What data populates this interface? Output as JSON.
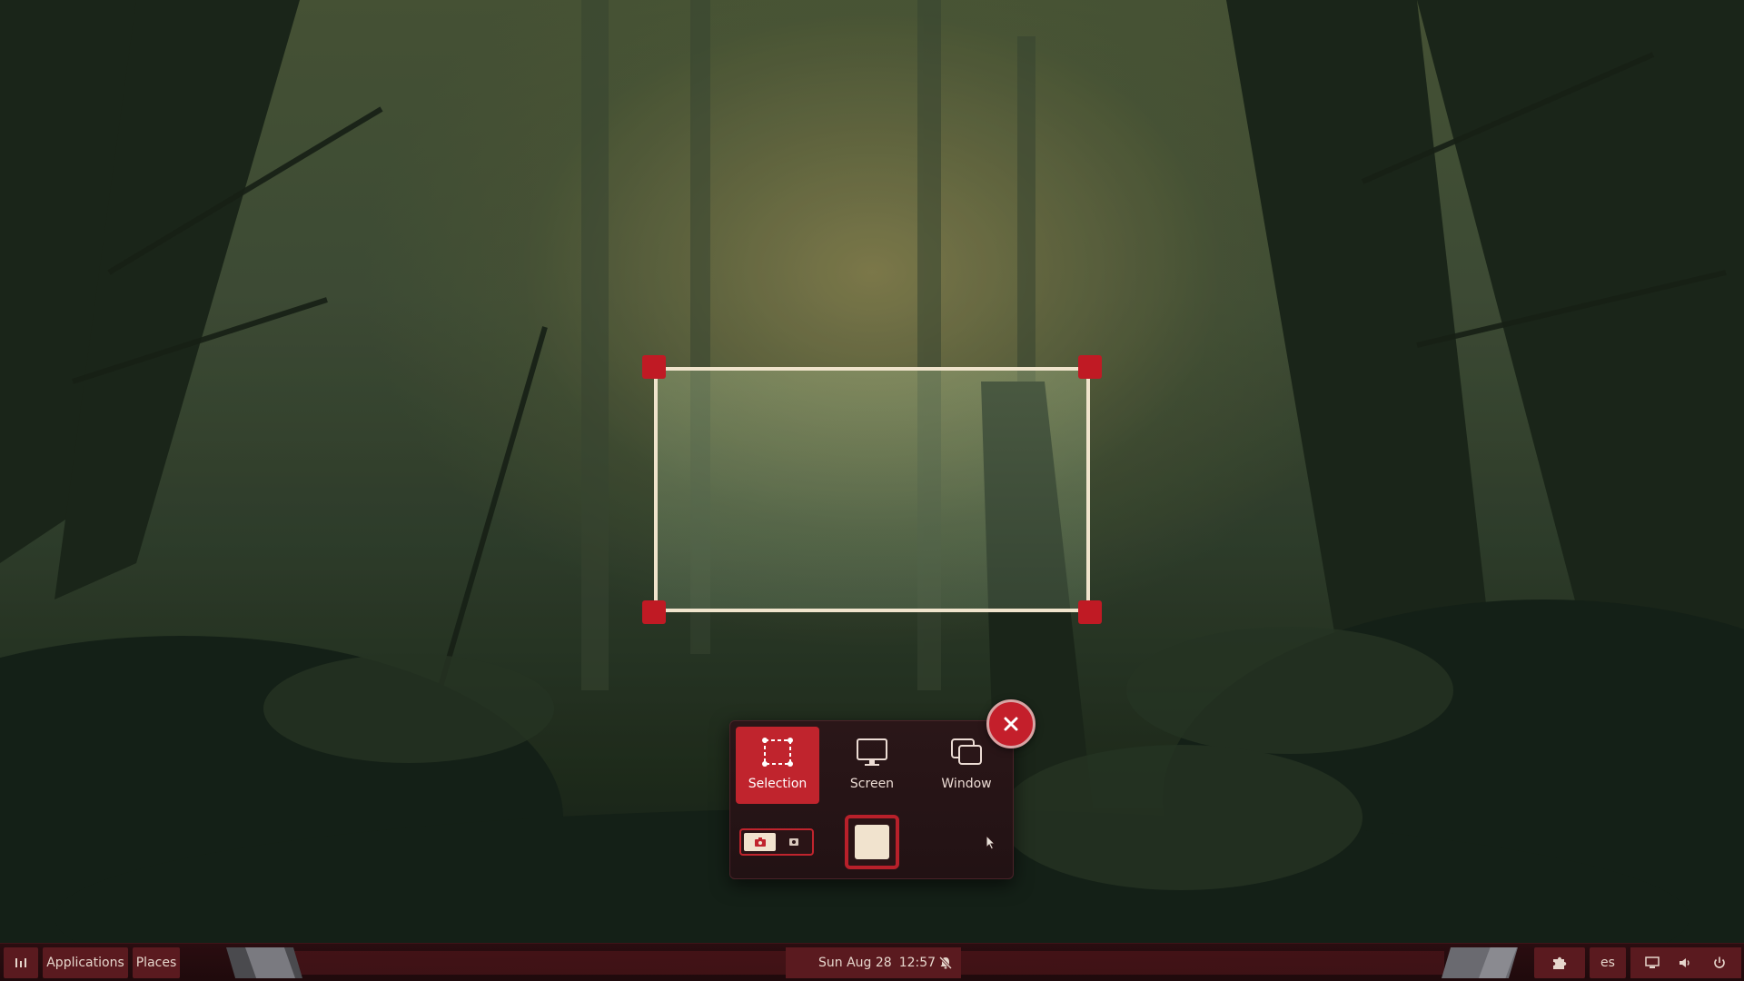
{
  "screenshot_ui": {
    "modes": [
      {
        "label": "Selection",
        "icon": "selection-icon",
        "selected": true
      },
      {
        "label": "Screen",
        "icon": "monitor-icon",
        "selected": false
      },
      {
        "label": "Window",
        "icon": "window-icon",
        "selected": false
      }
    ],
    "capture_type": {
      "options": [
        "screenshot",
        "screencast"
      ],
      "selected": "screenshot"
    },
    "show_pointer": true
  },
  "taskbar": {
    "menu_icon": "menu-icon",
    "applications_label": "Applications",
    "places_label": "Places",
    "clock": {
      "date": "Sun Aug 28",
      "time": "12:57"
    },
    "keyboard_layout": "es",
    "tray_icons": [
      "extensions-icon",
      "display-icon",
      "volume-icon",
      "power-icon"
    ]
  },
  "colors": {
    "accent": "#c0242d",
    "cream": "#f1e3ce",
    "panel_bg": "#221214",
    "taskbar_bg": "#1f0a0c",
    "taskbar_button": "#5a1a1f"
  }
}
